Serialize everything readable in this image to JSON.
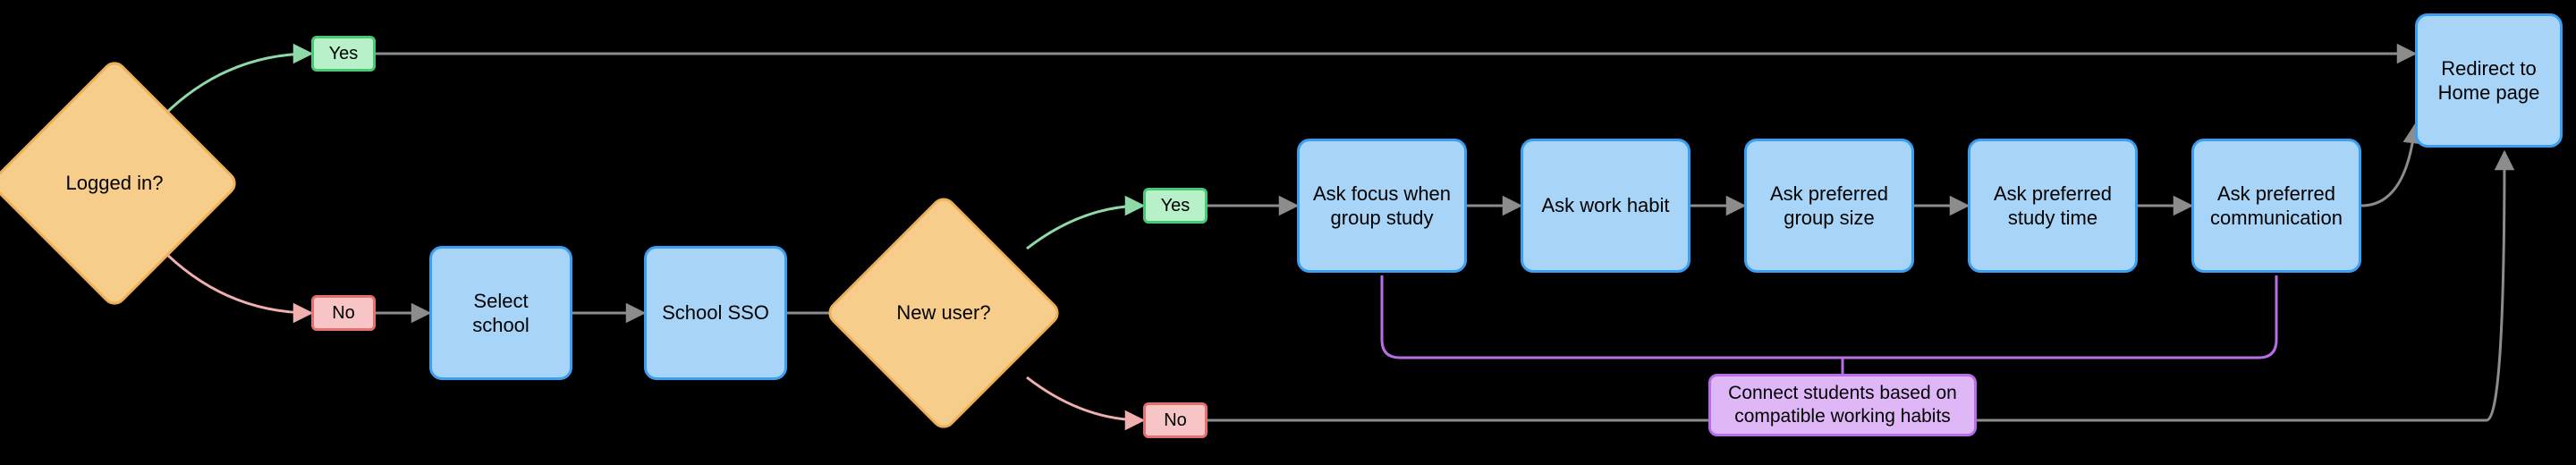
{
  "decisions": {
    "logged_in": "Logged in?",
    "new_user": "New user?"
  },
  "branches": {
    "yes": "Yes",
    "no": "No"
  },
  "steps": {
    "select_school": "Select school",
    "school_sso": "School SSO",
    "ask_focus": "Ask focus when group study",
    "ask_work_habit": "Ask work habit",
    "ask_group_size": "Ask preferred group size",
    "ask_study_time": "Ask preferred study time",
    "ask_comm": "Ask preferred communication",
    "redirect_home": "Redirect to Home page"
  },
  "annotation": {
    "connect_habits": "Connect students based on compatible working habits"
  },
  "colors": {
    "process_fill": "#a8d5f7",
    "process_stroke": "#3a9ff2",
    "decision_fill": "#f7cd8b",
    "decision_stroke": "#eeb15a",
    "yes_fill": "#b8f0c9",
    "yes_stroke": "#48c774",
    "no_fill": "#f7c5c5",
    "no_stroke": "#e46f6f",
    "annotation_fill": "#dfb7f7",
    "annotation_stroke": "#b86ee8",
    "edge_gray": "#8c8c8c",
    "edge_green": "#8fd9a8",
    "edge_pink": "#f0b0b0"
  }
}
